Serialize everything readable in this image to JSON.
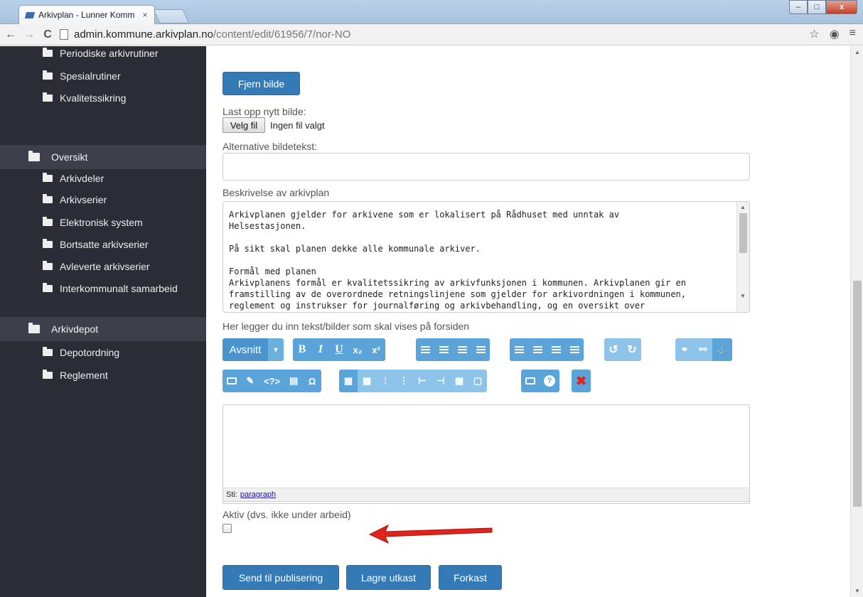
{
  "browser": {
    "tab_title": "Arkivplan - Lunner Komm",
    "tab_close": "×",
    "url_host": "admin.kommune.arkivplan.no",
    "url_path": "/content/edit/61956/7/nor-NO",
    "back": "←",
    "forward": "→",
    "reload": "C",
    "star": "☆",
    "menu": "≡",
    "ext": "◉",
    "win_min": "–",
    "win_max": "□",
    "win_close": "x"
  },
  "sidebar": {
    "top_items": [
      "Periodiske arkivrutiner",
      "Spesialrutiner",
      "Kvalitetssikring"
    ],
    "section1": "Oversikt",
    "section1_items": [
      "Arkivdeler",
      "Arkivserier",
      "Elektronisk system",
      "Bortsatte arkivserier",
      "Avleverte arkivserier",
      "Interkommunalt samarbeid"
    ],
    "section2": "Arkivdepot",
    "section2_items": [
      "Depotordning",
      "Reglement"
    ]
  },
  "form": {
    "remove_image_button": "Fjern bilde",
    "upload_label": "Last opp nytt bilde:",
    "choose_file_button": "Velg fil",
    "no_file_text": "Ingen fil valgt",
    "alt_text_label": "Alternative bildetekst:",
    "alt_text_value": "",
    "description_label": "Beskrivelse av arkivplan",
    "description_text": "Arkivplanen gjelder for arkivene som er lokalisert på Rådhuset med unntak av\nHelsestasjonen.\n\nPå sikt skal planen dekke alle kommunale arkiver.\n\nFormål med planen\nArkivplanens formål er kvalitetssikring av arkivfunksjonen i kommunen. Arkivplanen gir en\nframstilling av de overordnede retningslinjene som gjelder for arkivordningen i kommunen,\nreglement og instrukser for journalføring og arkivbehandling, og en oversikt over",
    "frontpage_label": "Her legger du inn tekst/bilder som skal vises på forsiden",
    "editor_format": "Avsnitt",
    "statusbar_label": "Sti:",
    "statusbar_path": "paragraph",
    "active_label": "Aktiv (dvs. ikke under arbeid)",
    "active_checked": false,
    "submit_button": "Send til publisering",
    "save_draft_button": "Lagre utkast",
    "discard_button": "Forkast"
  },
  "editor_toolbar": {
    "bold": "B",
    "italic": "I",
    "underline": "U",
    "subscript": "x₂",
    "superscript": "x²",
    "undo": "↺",
    "redo": "↻",
    "anchor": "⚓",
    "code": "<?>",
    "omega": "Ω",
    "help": "?",
    "remove": "✖",
    "dropdown": "▾"
  },
  "colors": {
    "sidebar_bg": "#2b2d36",
    "sidebar_section_bg": "#3d3f4b",
    "primary_button": "#337ab7",
    "editor_button": "#5aa4d9",
    "arrow": "#e0241b"
  }
}
